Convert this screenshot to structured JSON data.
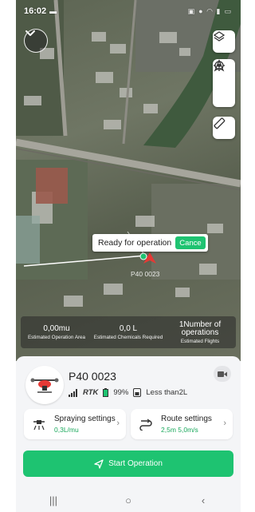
{
  "status_bar": {
    "time": "16:02"
  },
  "map": {
    "tooltip": {
      "text": "Ready for operation",
      "cancel_label": "Cance"
    },
    "drone_label": "P40 0023"
  },
  "stats": [
    {
      "value": "0,00mu",
      "label": "Estimated Operation Area"
    },
    {
      "value": "0,0 L",
      "label": "Estimated Chemicals Required"
    },
    {
      "value": "1Number of operations",
      "label": "Estimated Flights"
    }
  ],
  "drone": {
    "name": "P40 0023",
    "signal_label": "RTK",
    "battery": "99%",
    "tank": "Less than2L"
  },
  "settings": {
    "spraying": {
      "title": "Spraying settings",
      "value": "0,3L/mu"
    },
    "route": {
      "title": "Route settings",
      "value": "2,5m 5,0m/s"
    }
  },
  "start_button_label": "Start Operation",
  "colors": {
    "accent": "#1ec371",
    "value_green": "#1aa85c"
  },
  "icons": [
    "chevron-down-icon",
    "layers-icon",
    "navigation-icon",
    "locate-icon",
    "ruler-icon",
    "video-icon",
    "spray-icon",
    "route-icon",
    "send-icon"
  ]
}
